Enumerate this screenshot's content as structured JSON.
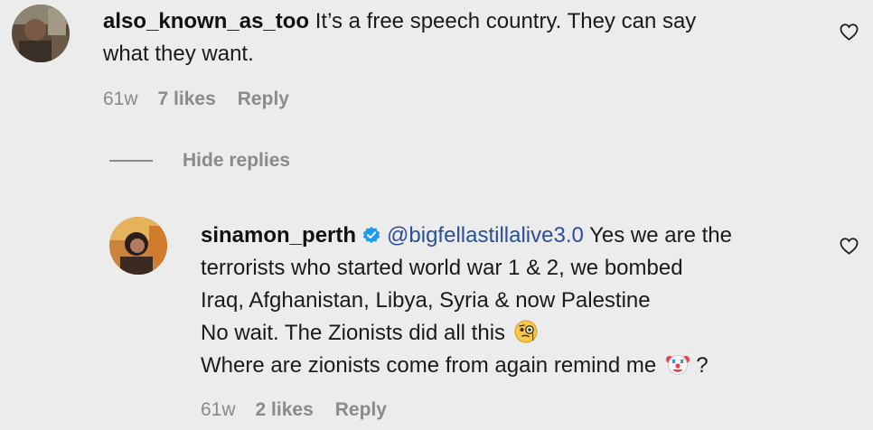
{
  "comments": [
    {
      "username": "also_known_as_too",
      "text_line1": "It’s a free speech country. They can say",
      "text_line2": "what they want.",
      "time": "61w",
      "likes": "7 likes",
      "reply_label": "Reply",
      "avatar_icon": "user-avatar-photo",
      "like_icon": "heart-outline-icon"
    }
  ],
  "hide_replies_label": "Hide replies",
  "replies": [
    {
      "username": "sinamon_perth",
      "verified_icon": "verified-badge-icon",
      "mention": "@bigfellastillalive3.0",
      "text_line1": "Yes we are the",
      "text_line2": "terrorists who started world war 1 & 2, we bombed",
      "text_line3": "Iraq, Afghanistan, Libya, Syria & now Palestine",
      "text_line4": "No wait. The Zionists did all this",
      "text_line5": "Where are zionists come from again remind me",
      "text_line5_suffix": "?",
      "emoji1": "face-with-monocle-emoji",
      "emoji2": "clown-face-emoji",
      "time": "61w",
      "likes": "2 likes",
      "reply_label": "Reply",
      "avatar_icon": "user-avatar-photo",
      "like_icon": "heart-outline-icon"
    }
  ],
  "colors": {
    "background": "#ececec",
    "mention": "#2a4f9a",
    "verified": "#1d9bf0",
    "meta": "#8a8a8a"
  }
}
